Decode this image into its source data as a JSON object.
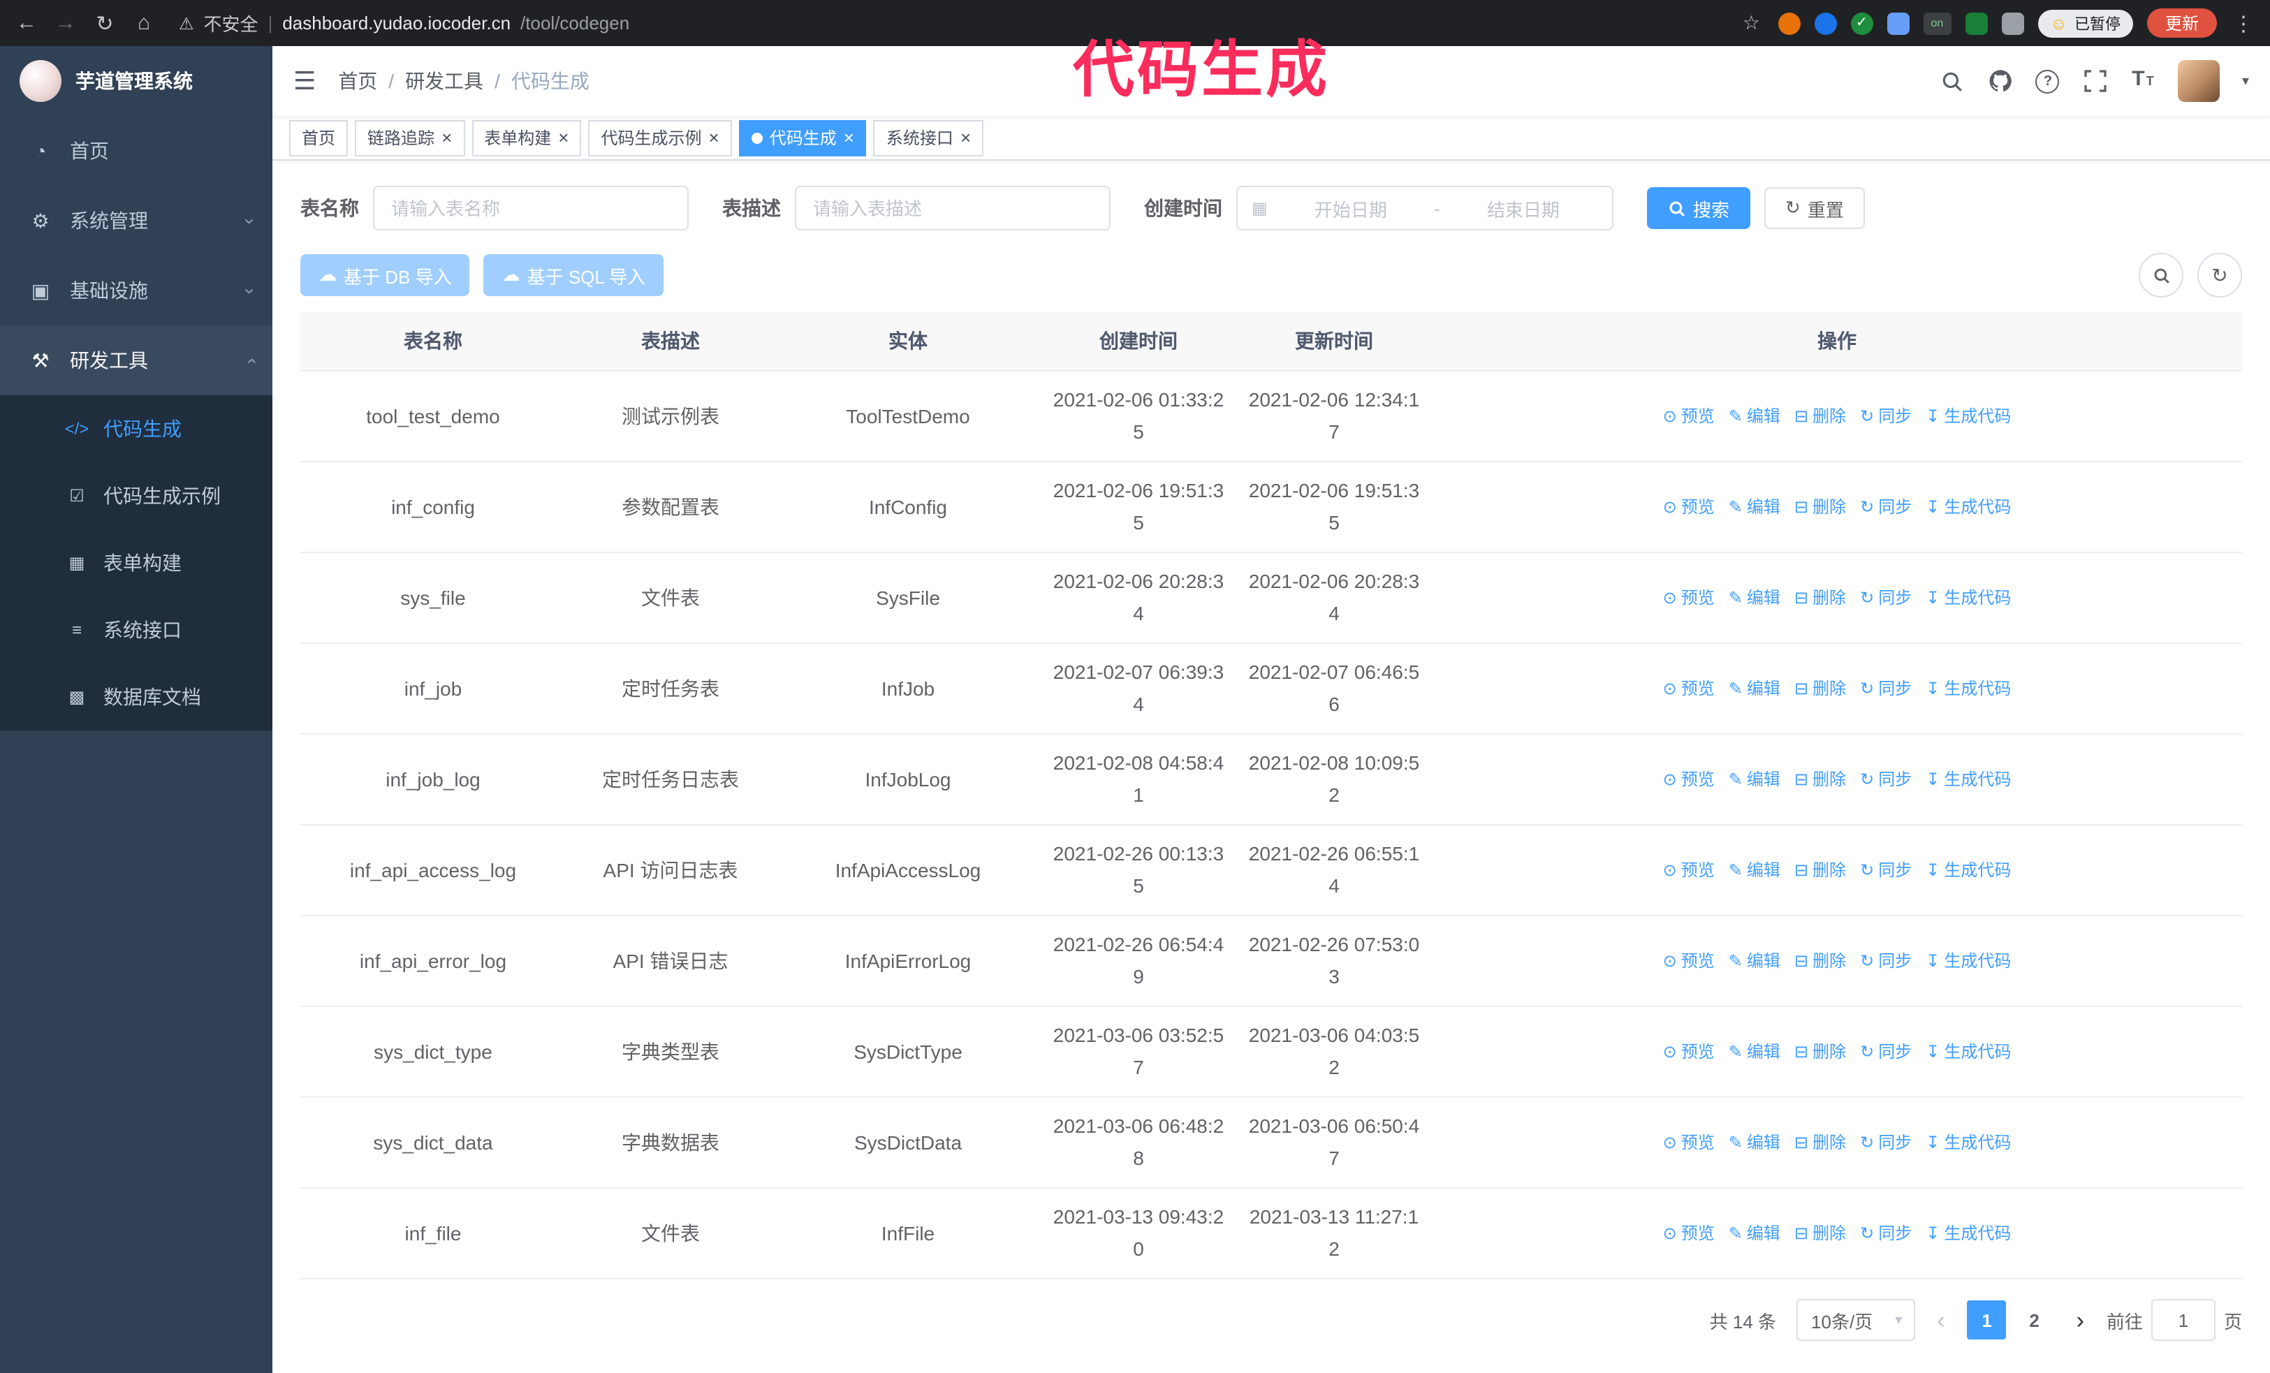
{
  "browser": {
    "warning_text": "不安全",
    "url_host": "dashboard.yudao.iocoder.cn",
    "url_path": "/tool/codegen",
    "on_badge": "on",
    "paused_chip": "已暂停",
    "update_button": "更新"
  },
  "annotation": {
    "text": "代码生成",
    "color": "#fa2c5c"
  },
  "sidebar": {
    "title": "芋道管理系统",
    "menu": [
      {
        "label": "首页",
        "icon": "home-icon",
        "expandable": false,
        "expanded": false
      },
      {
        "label": "系统管理",
        "icon": "gear-icon",
        "expandable": true,
        "expanded": false
      },
      {
        "label": "基础设施",
        "icon": "infra-icon",
        "expandable": true,
        "expanded": false
      },
      {
        "label": "研发工具",
        "icon": "tools-icon",
        "expandable": true,
        "expanded": true
      }
    ],
    "submenu": [
      {
        "label": "代码生成",
        "icon": "code-icon",
        "active": true
      },
      {
        "label": "代码生成示例",
        "icon": "example-icon",
        "active": false
      },
      {
        "label": "表单构建",
        "icon": "form-icon",
        "active": false
      },
      {
        "label": "系统接口",
        "icon": "api-icon",
        "active": false
      },
      {
        "label": "数据库文档",
        "icon": "db-doc-icon",
        "active": false
      }
    ]
  },
  "header": {
    "breadcrumb": [
      "首页",
      "研发工具",
      "代码生成"
    ]
  },
  "tabs": [
    {
      "label": "首页",
      "closable": false,
      "active": false
    },
    {
      "label": "链路追踪",
      "closable": true,
      "active": false
    },
    {
      "label": "表单构建",
      "closable": true,
      "active": false
    },
    {
      "label": "代码生成示例",
      "closable": true,
      "active": false
    },
    {
      "label": "代码生成",
      "closable": true,
      "active": true
    },
    {
      "label": "系统接口",
      "closable": true,
      "active": false
    }
  ],
  "filters": {
    "table_name_label": "表名称",
    "table_name_placeholder": "请输入表名称",
    "table_desc_label": "表描述",
    "table_desc_placeholder": "请输入表描述",
    "create_time_label": "创建时间",
    "start_date_placeholder": "开始日期",
    "range_separator": "-",
    "end_date_placeholder": "结束日期",
    "search_button": "搜索",
    "reset_button": "重置"
  },
  "toolbar": {
    "import_db_button": "基于 DB 导入",
    "import_sql_button": "基于 SQL 导入"
  },
  "table": {
    "columns": [
      "表名称",
      "表描述",
      "实体",
      "创建时间",
      "更新时间",
      "操作"
    ],
    "action_labels": [
      "预览",
      "编辑",
      "删除",
      "同步",
      "生成代码"
    ],
    "action_icons": [
      "eye-icon",
      "edit-icon",
      "delete-icon",
      "sync-icon",
      "download-icon"
    ],
    "rows": [
      {
        "name": "tool_test_demo",
        "desc": "测试示例表",
        "entity": "ToolTestDemo",
        "created": "2021-02-06 01:33:25",
        "updated": "2021-02-06 12:34:17"
      },
      {
        "name": "inf_config",
        "desc": "参数配置表",
        "entity": "InfConfig",
        "created": "2021-02-06 19:51:35",
        "updated": "2021-02-06 19:51:35"
      },
      {
        "name": "sys_file",
        "desc": "文件表",
        "entity": "SysFile",
        "created": "2021-02-06 20:28:34",
        "updated": "2021-02-06 20:28:34"
      },
      {
        "name": "inf_job",
        "desc": "定时任务表",
        "entity": "InfJob",
        "created": "2021-02-07 06:39:34",
        "updated": "2021-02-07 06:46:56"
      },
      {
        "name": "inf_job_log",
        "desc": "定时任务日志表",
        "entity": "InfJobLog",
        "created": "2021-02-08 04:58:41",
        "updated": "2021-02-08 10:09:52"
      },
      {
        "name": "inf_api_access_log",
        "desc": "API 访问日志表",
        "entity": "InfApiAccessLog",
        "created": "2021-02-26 00:13:35",
        "updated": "2021-02-26 06:55:14"
      },
      {
        "name": "inf_api_error_log",
        "desc": "API 错误日志",
        "entity": "InfApiErrorLog",
        "created": "2021-02-26 06:54:49",
        "updated": "2021-02-26 07:53:03"
      },
      {
        "name": "sys_dict_type",
        "desc": "字典类型表",
        "entity": "SysDictType",
        "created": "2021-03-06 03:52:57",
        "updated": "2021-03-06 04:03:52"
      },
      {
        "name": "sys_dict_data",
        "desc": "字典数据表",
        "entity": "SysDictData",
        "created": "2021-03-06 06:48:28",
        "updated": "2021-03-06 06:50:47"
      },
      {
        "name": "inf_file",
        "desc": "文件表",
        "entity": "InfFile",
        "created": "2021-03-13 09:43:20",
        "updated": "2021-03-13 11:27:12"
      }
    ]
  },
  "pagination": {
    "total_text": "共 14 条",
    "page_size": "10条/页",
    "pages": [
      "1",
      "2"
    ],
    "current_page": "1",
    "goto_prefix": "前往",
    "goto_value": "1",
    "goto_suffix": "页"
  }
}
